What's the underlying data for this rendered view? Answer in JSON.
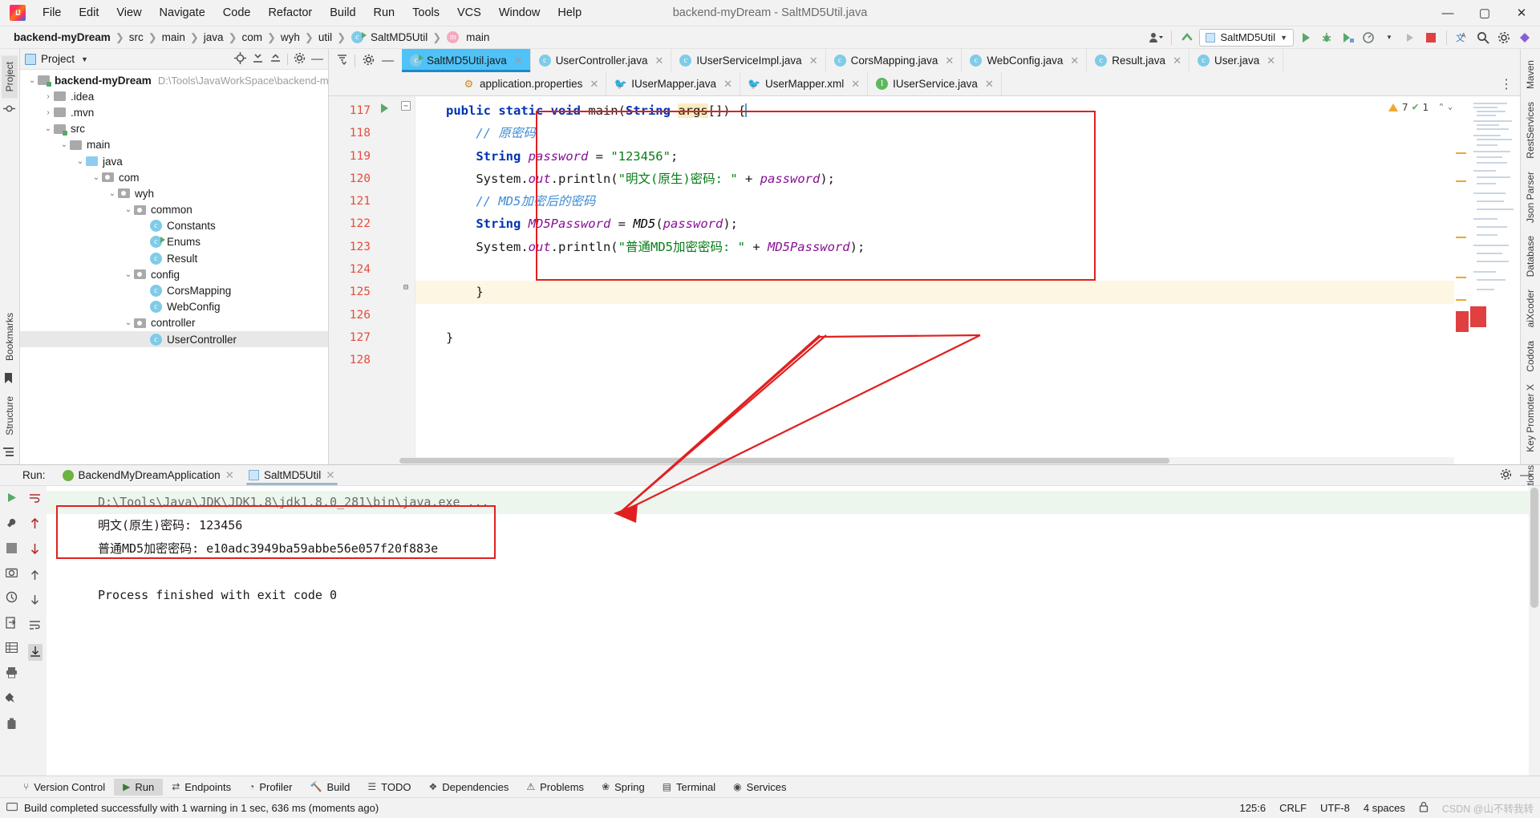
{
  "window": {
    "title": "backend-myDream - SaltMD5Util.java",
    "minimize": "—",
    "maximize": "▢",
    "close": "✕"
  },
  "menu": [
    "File",
    "Edit",
    "View",
    "Navigate",
    "Code",
    "Refactor",
    "Build",
    "Run",
    "Tools",
    "VCS",
    "Window",
    "Help"
  ],
  "navbar": {
    "crumbs": [
      "backend-myDream",
      "src",
      "main",
      "java",
      "com",
      "wyh",
      "util",
      "SaltMD5Util",
      "main"
    ],
    "run_config": "SaltMD5Util"
  },
  "project_panel": {
    "header": "Project",
    "root": "backend-myDream",
    "root_path": "D:\\Tools\\JavaWorkSpace\\backend-m",
    "tree": [
      {
        "label": ".idea",
        "type": "folder",
        "depth": 1,
        "arrow": "›"
      },
      {
        "label": ".mvn",
        "type": "folder",
        "depth": 1,
        "arrow": "›"
      },
      {
        "label": "src",
        "type": "folder-src",
        "depth": 1,
        "arrow": "⌄"
      },
      {
        "label": "main",
        "type": "folder",
        "depth": 2,
        "arrow": "⌄"
      },
      {
        "label": "java",
        "type": "folder-blue",
        "depth": 3,
        "arrow": "⌄"
      },
      {
        "label": "com",
        "type": "pkg",
        "depth": 4,
        "arrow": "⌄"
      },
      {
        "label": "wyh",
        "type": "pkg",
        "depth": 5,
        "arrow": "⌄"
      },
      {
        "label": "common",
        "type": "pkg",
        "depth": 6,
        "arrow": "⌄"
      },
      {
        "label": "Constants",
        "type": "class",
        "depth": 7,
        "arrow": ""
      },
      {
        "label": "Enums",
        "type": "class-run",
        "depth": 7,
        "arrow": ""
      },
      {
        "label": "Result",
        "type": "class",
        "depth": 7,
        "arrow": ""
      },
      {
        "label": "config",
        "type": "pkg",
        "depth": 6,
        "arrow": "⌄"
      },
      {
        "label": "CorsMapping",
        "type": "class",
        "depth": 7,
        "arrow": ""
      },
      {
        "label": "WebConfig",
        "type": "class",
        "depth": 7,
        "arrow": ""
      },
      {
        "label": "controller",
        "type": "pkg",
        "depth": 6,
        "arrow": "⌄"
      },
      {
        "label": "UserController",
        "type": "class",
        "depth": 7,
        "arrow": "",
        "selected": true
      }
    ]
  },
  "editor_tabs_row1": [
    {
      "label": "SaltMD5Util.java",
      "icon": "class-run-icon",
      "active": true
    },
    {
      "label": "UserController.java",
      "icon": "class-icon",
      "active": false
    },
    {
      "label": "IUserServiceImpl.java",
      "icon": "class-icon",
      "active": false
    },
    {
      "label": "CorsMapping.java",
      "icon": "class-icon",
      "active": false
    },
    {
      "label": "WebConfig.java",
      "icon": "class-icon",
      "active": false
    },
    {
      "label": "Result.java",
      "icon": "class-icon",
      "active": false
    },
    {
      "label": "User.java",
      "icon": "class-icon",
      "active": false
    }
  ],
  "editor_tabs_row2": [
    {
      "label": "application.properties",
      "icon": "properties-icon",
      "active": false
    },
    {
      "label": "IUserMapper.java",
      "icon": "mybatis-icon",
      "active": false
    },
    {
      "label": "UserMapper.xml",
      "icon": "mybatis-xml-icon",
      "active": false
    },
    {
      "label": "IUserService.java",
      "icon": "interface-icon",
      "active": false
    }
  ],
  "editor": {
    "line_numbers": [
      "117",
      "118",
      "119",
      "120",
      "121",
      "122",
      "123",
      "124",
      "125",
      "126",
      "127",
      "128"
    ],
    "code_lines": [
      {
        "n": "117",
        "segments": [
          {
            "t": "public static void ",
            "c": "k"
          },
          {
            "t": "main",
            "c": "mth"
          },
          {
            "t": "(",
            "c": ""
          },
          {
            "t": "String ",
            "c": "k"
          },
          {
            "t": "args",
            "c": "hlword"
          },
          {
            "t": "[]) {",
            "c": ""
          }
        ]
      },
      {
        "n": "118",
        "segments": [
          {
            "t": "    // 原密码",
            "c": "cmt"
          }
        ]
      },
      {
        "n": "119",
        "segments": [
          {
            "t": "    String ",
            "c": "k"
          },
          {
            "t": "password",
            "c": "fld"
          },
          {
            "t": " = ",
            "c": ""
          },
          {
            "t": "\"123456\"",
            "c": "str"
          },
          {
            "t": ";",
            "c": ""
          }
        ]
      },
      {
        "n": "120",
        "segments": [
          {
            "t": "    System.",
            "c": ""
          },
          {
            "t": "out",
            "c": "fld"
          },
          {
            "t": ".println(",
            "c": ""
          },
          {
            "t": "\"明文(原生)密码: \"",
            "c": "str"
          },
          {
            "t": " + ",
            "c": ""
          },
          {
            "t": "password",
            "c": "fld"
          },
          {
            "t": ");",
            "c": ""
          }
        ]
      },
      {
        "n": "121",
        "segments": [
          {
            "t": "    // MD5加密后的密码",
            "c": "cmt"
          }
        ]
      },
      {
        "n": "122",
        "segments": [
          {
            "t": "    String ",
            "c": "k"
          },
          {
            "t": "MD5Password",
            "c": "fld"
          },
          {
            "t": " = ",
            "c": ""
          },
          {
            "t": "MD5",
            "c": "stat"
          },
          {
            "t": "(",
            "c": ""
          },
          {
            "t": "password",
            "c": "fld"
          },
          {
            "t": ");",
            "c": ""
          }
        ]
      },
      {
        "n": "123",
        "segments": [
          {
            "t": "    System.",
            "c": ""
          },
          {
            "t": "out",
            "c": "fld"
          },
          {
            "t": ".println(",
            "c": ""
          },
          {
            "t": "\"普通MD5加密密码: \"",
            "c": "str"
          },
          {
            "t": " + ",
            "c": ""
          },
          {
            "t": "MD5Password",
            "c": "fld"
          },
          {
            "t": ");",
            "c": ""
          }
        ]
      },
      {
        "n": "124",
        "segments": [
          {
            "t": "",
            "c": ""
          }
        ]
      },
      {
        "n": "125",
        "segments": [
          {
            "t": "    }",
            "c": ""
          }
        ],
        "highlight": true
      },
      {
        "n": "126",
        "segments": [
          {
            "t": "",
            "c": ""
          }
        ]
      },
      {
        "n": "127",
        "segments": [
          {
            "t": "}",
            "c": ""
          }
        ]
      },
      {
        "n": "128",
        "segments": [
          {
            "t": "",
            "c": ""
          }
        ]
      }
    ],
    "inspection": {
      "warnings": "7",
      "checks": "1"
    }
  },
  "run_panel": {
    "label": "Run:",
    "tabs": [
      {
        "label": "BackendMyDreamApplication",
        "selected": false
      },
      {
        "label": "SaltMD5Util",
        "selected": true
      }
    ],
    "console": [
      {
        "text": "D:\\Tools\\Java\\JDK\\JDK1.8\\jdk1.8.0_281\\bin\\java.exe ...",
        "style": "cmd"
      },
      {
        "text": "明文(原生)密码: 123456",
        "style": "out"
      },
      {
        "text": "普通MD5加密密码: e10adc3949ba59abbe56e057f20f883e",
        "style": "out"
      },
      {
        "text": "",
        "style": "out"
      },
      {
        "text": "Process finished with exit code 0",
        "style": "out"
      }
    ]
  },
  "bottom_tools": [
    {
      "label": "Version Control",
      "icon": "branch-icon",
      "selected": false
    },
    {
      "label": "Run",
      "icon": "play-icon",
      "selected": true
    },
    {
      "label": "Endpoints",
      "icon": "endpoints-icon",
      "selected": false
    },
    {
      "label": "Profiler",
      "icon": "profiler-icon",
      "selected": false
    },
    {
      "label": "Build",
      "icon": "hammer-icon",
      "selected": false
    },
    {
      "label": "TODO",
      "icon": "todo-icon",
      "selected": false
    },
    {
      "label": "Dependencies",
      "icon": "dependencies-icon",
      "selected": false
    },
    {
      "label": "Problems",
      "icon": "problems-icon",
      "selected": false
    },
    {
      "label": "Spring",
      "icon": "spring-icon",
      "selected": false
    },
    {
      "label": "Terminal",
      "icon": "terminal-icon",
      "selected": false
    },
    {
      "label": "Services",
      "icon": "services-icon",
      "selected": false
    }
  ],
  "left_strip": [
    "Project",
    "Bookmarks",
    "Structure"
  ],
  "right_strip": [
    "Maven",
    "RestServices",
    "Json Parser",
    "Database",
    "aiXcoder",
    "Codota",
    "Key Promoter X",
    "Notifications"
  ],
  "status_bar": {
    "message": "Build completed successfully with 1 warning in 1 sec, 636 ms (moments ago)",
    "caret": "125:6",
    "line_sep": "CRLF",
    "encoding": "UTF-8",
    "indent": "4 spaces",
    "watermark": "CSDN @山不转我转"
  },
  "colors": {
    "accent": "#4fc3f7",
    "annotation_red": "#e02020",
    "keyword_blue": "#0033b3",
    "string_green": "#067d17",
    "comment_blue": "#3d8bd6",
    "linenum_red": "#e74c3c"
  }
}
